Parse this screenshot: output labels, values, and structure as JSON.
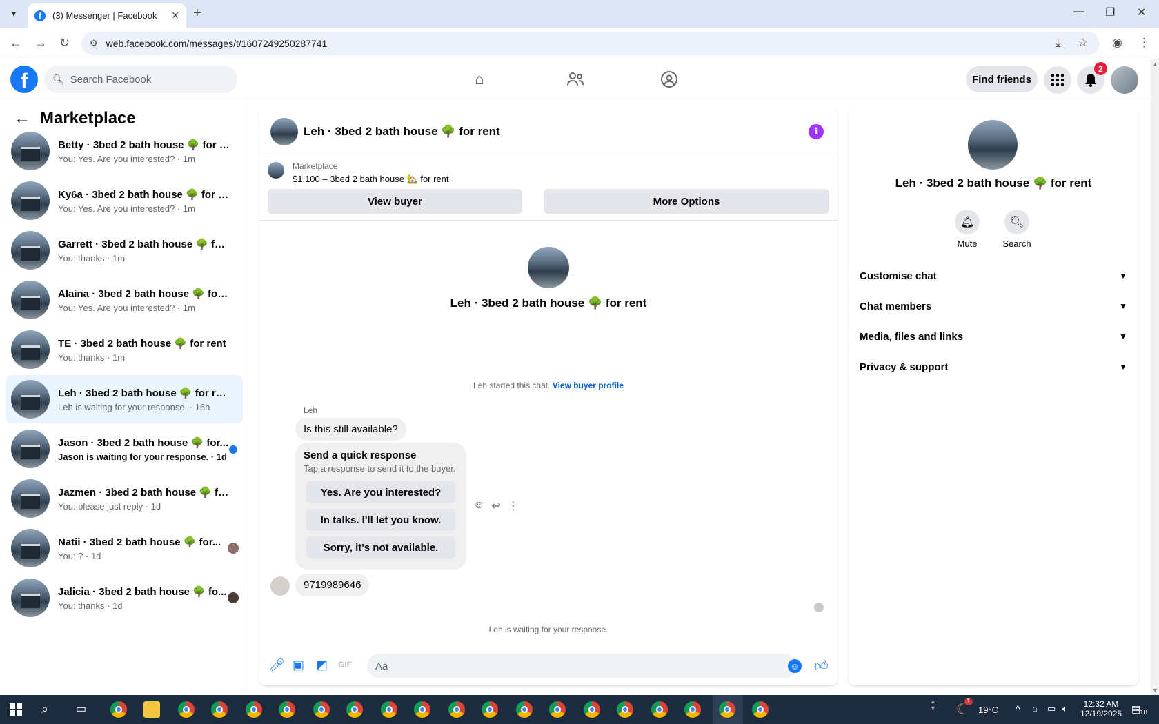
{
  "browser": {
    "tab_title": "(3) Messenger | Facebook",
    "url": "web.facebook.com/messages/t/1607249250287741"
  },
  "header": {
    "search_placeholder": "Search Facebook",
    "find_friends": "Find friends",
    "notification_count": "2"
  },
  "sidebar": {
    "title": "Marketplace",
    "conversations": [
      {
        "name": "Betty · 3bed 2 bath house 🌳 for r...",
        "sub": "You: Yes. Are you interested? · 1m"
      },
      {
        "name": "Ky6a · 3bed 2 bath house 🌳 for re...",
        "sub": "You: Yes. Are you interested? · 1m"
      },
      {
        "name": "Garrett · 3bed 2 bath house 🌳 for...",
        "sub": "You: thanks · 1m"
      },
      {
        "name": "Alaina · 3bed 2 bath house 🌳 for ...",
        "sub": "You: Yes. Are you interested? · 1m"
      },
      {
        "name": "TE · 3bed 2 bath house 🌳 for rent",
        "sub": "You: thanks · 1m"
      },
      {
        "name": "Leh · 3bed 2 bath house 🌳 for rent",
        "sub": "Leh is waiting for your response. · 16h"
      },
      {
        "name": "Jason · 3bed 2 bath house 🌳 for...",
        "sub": "Jason is waiting for your response. · 1d"
      },
      {
        "name": "Jazmen · 3bed 2 bath house 🌳 for...",
        "sub": "You: please just reply · 1d"
      },
      {
        "name": "Natii · 3bed 2 bath house 🌳 for...",
        "sub": "You: ? · 1d"
      },
      {
        "name": "Jalicia · 3bed 2 bath house 🌳 fo...",
        "sub": "You: thanks · 1d"
      }
    ]
  },
  "chat": {
    "title": "Leh · 3bed 2 bath house 🌳 for rent",
    "marketplace_label": "Marketplace",
    "listing": "$1,100 – 3bed 2 bath house 🏡 for rent",
    "view_buyer": "View buyer",
    "more_options": "More Options",
    "profile_name": "Leh · 3bed 2 bath house 🌳 for rent",
    "started_text": "Leh started this chat.",
    "view_buyer_profile": "View buyer profile",
    "sender": "Leh",
    "message1": "Is this still available?",
    "quick_title": "Send a quick response",
    "quick_sub": "Tap a response to send it to the buyer.",
    "quick_options": [
      "Yes. Are you interested?",
      "In talks. I'll let you know.",
      "Sorry, it's not available."
    ],
    "message2": "9719989646",
    "waiting": "Leh is waiting for your response.",
    "composer_placeholder": "Aa"
  },
  "right_panel": {
    "name": "Leh · 3bed 2 bath house 🌳 for rent",
    "mute": "Mute",
    "search": "Search",
    "sections": [
      "Customise chat",
      "Chat members",
      "Media, files and links",
      "Privacy & support"
    ]
  },
  "taskbar": {
    "temperature": "19°C",
    "time": "12:32 AM",
    "date": "12/19/2025",
    "notifications": "18",
    "weather_badge": "1"
  },
  "colors": {
    "brand": "#1877f2",
    "info": "#a033ff",
    "active_conv": "#ebf5ff"
  }
}
